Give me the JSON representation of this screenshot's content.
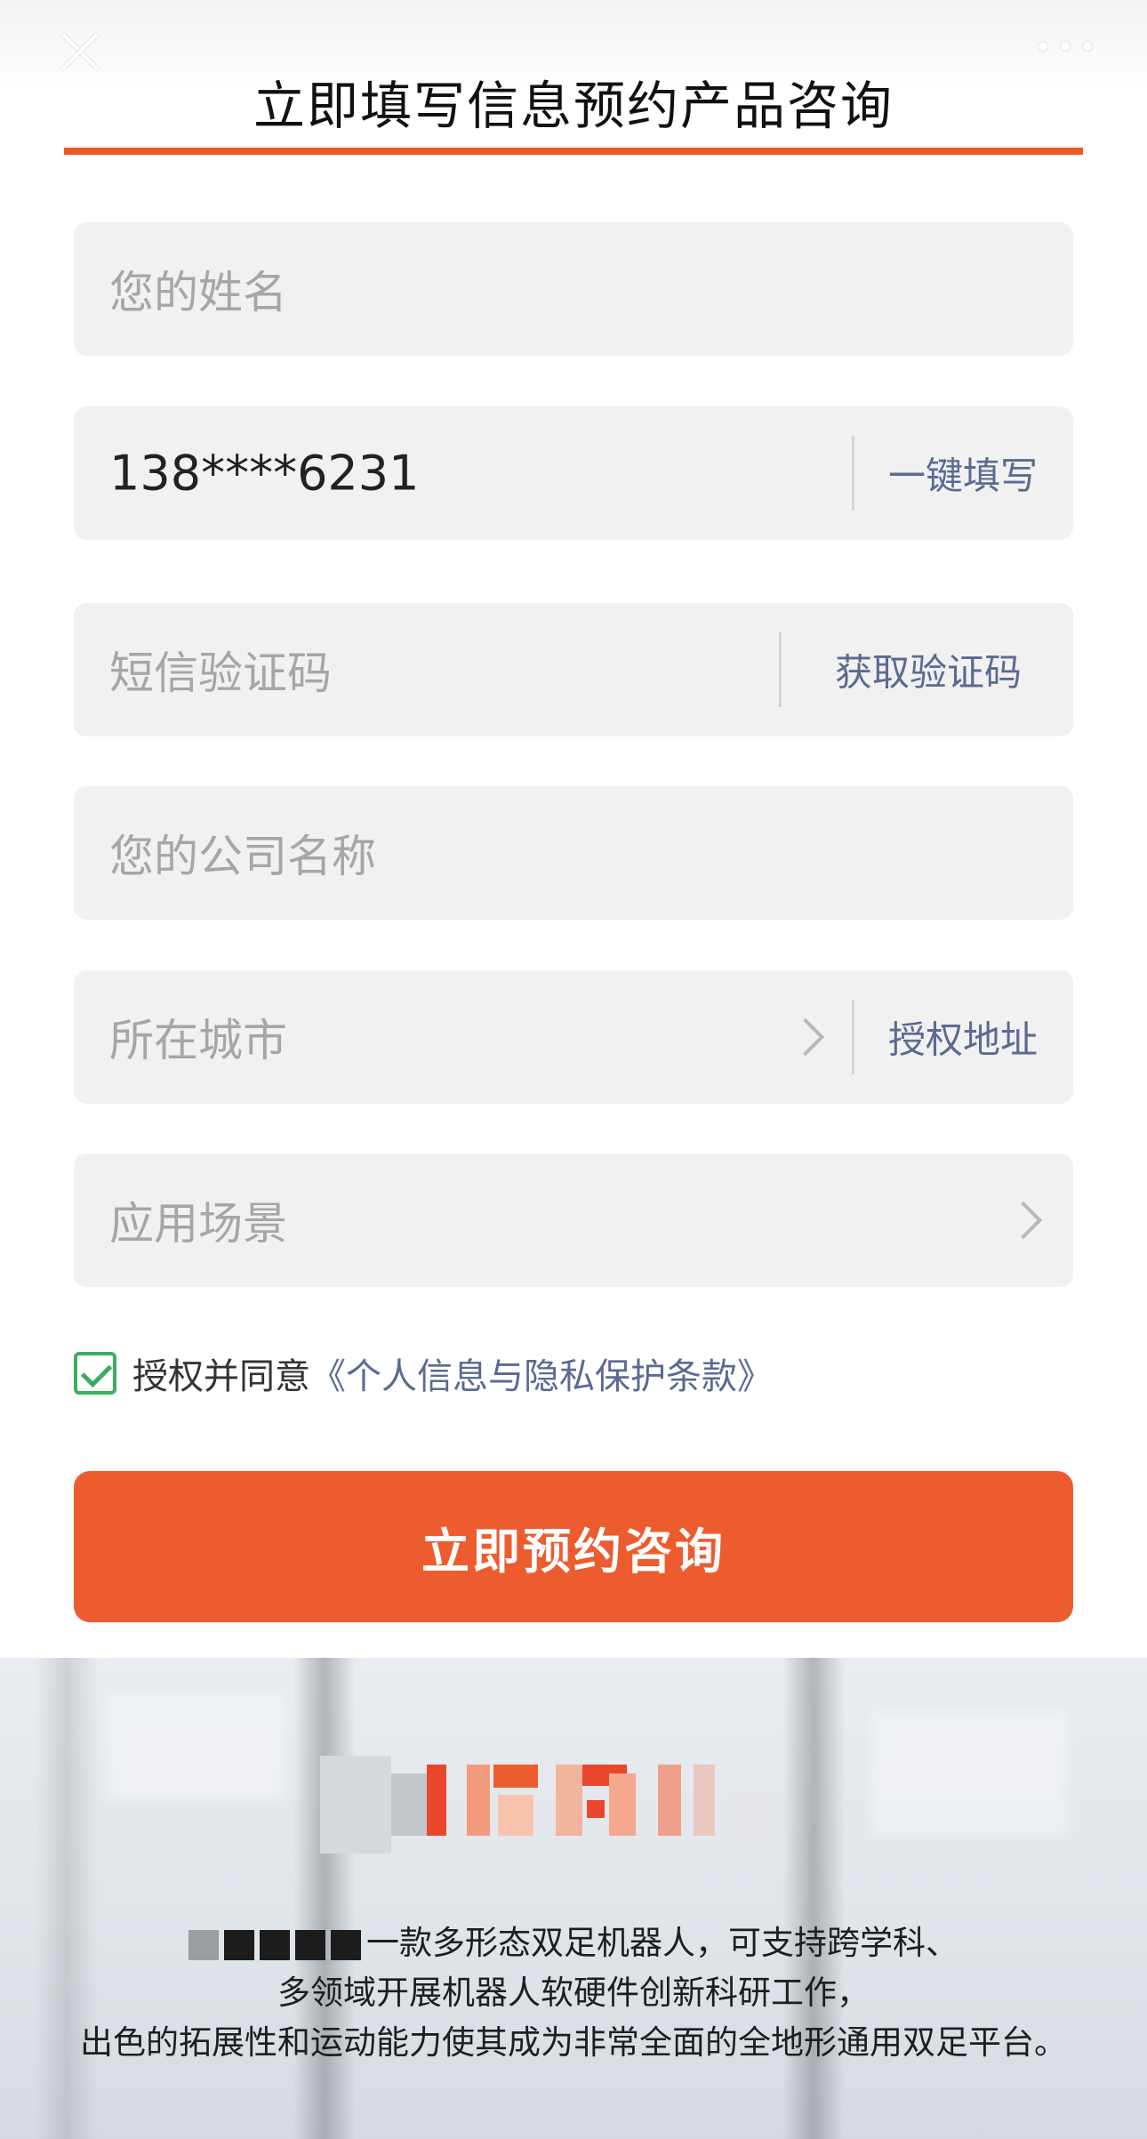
{
  "header": {
    "title": "立即填写信息预约产品咨询",
    "close_icon": "close-icon",
    "more_icon": "more-dots-icon"
  },
  "form": {
    "name_placeholder": "您的姓名",
    "phone_value": "138****6231",
    "phone_action": "一键填写",
    "sms_placeholder": "短信验证码",
    "sms_action": "获取验证码",
    "company_placeholder": "您的公司名称",
    "city_placeholder": "所在城市",
    "city_action": "授权地址",
    "scenario_placeholder": "应用场景"
  },
  "agreement": {
    "checked": true,
    "prefix": "授权并同意",
    "link": "《个人信息与隐私保护条款》"
  },
  "submit": {
    "label": "立即预约咨询"
  },
  "promo": {
    "line1": "一款多形态双足机器人，可支持跨学科、",
    "line2": "多领域开展机器人软硬件创新科研工作，",
    "line3": "出色的拓展性和运动能力使其成为非常全面的全地形通用双足平台。"
  },
  "colors": {
    "accent": "#ec5c2e",
    "link": "#5a6a92",
    "field_bg": "#f1f1f1",
    "check": "#3cae5e"
  }
}
